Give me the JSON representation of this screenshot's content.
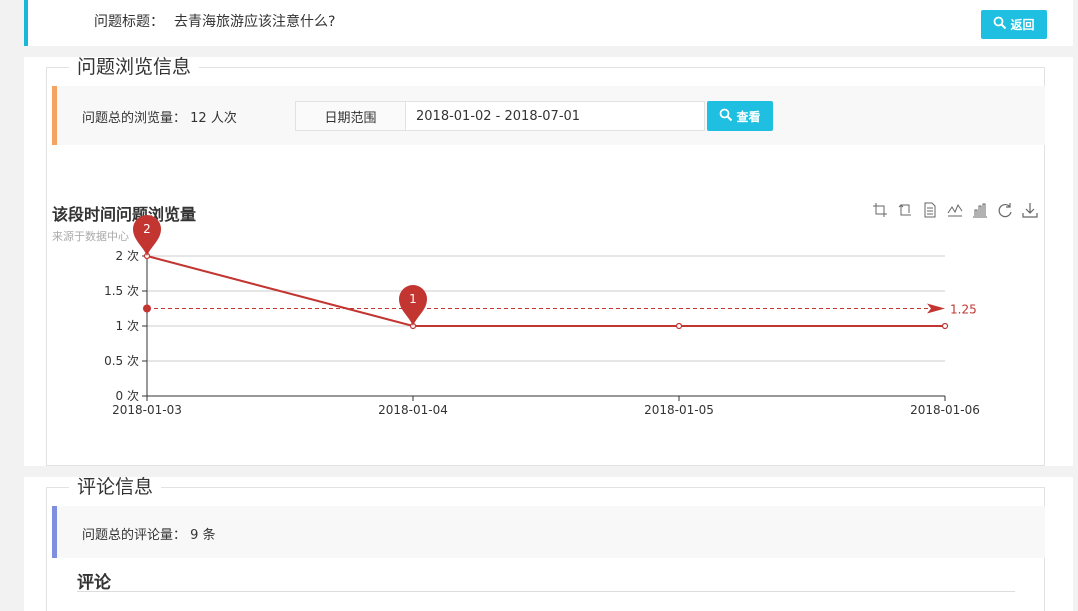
{
  "header": {
    "question_label": "问题标题：",
    "question_title": "去青海旅游应该注意什么?",
    "back_label": "返回"
  },
  "views_section": {
    "legend": "问题浏览信息",
    "total_views_label": "问题总的浏览量：",
    "total_views_value": "12 人次",
    "date_range_label": "日期范围",
    "date_range_value": "2018-01-02 - 2018-07-01",
    "view_button_label": "查看"
  },
  "chart_data": {
    "type": "line",
    "title": "该段时间问题浏览量",
    "subtitle": "来源于数据中心",
    "x": [
      "2018-01-03",
      "2018-01-04",
      "2018-01-05",
      "2018-01-06"
    ],
    "series": [
      {
        "values": [
          2,
          1,
          1,
          1
        ]
      }
    ],
    "ylim": [
      0,
      2
    ],
    "y_ticks": [
      "0 次",
      "0.5 次",
      "1 次",
      "1.5 次",
      "2 次"
    ],
    "mark_points": [
      {
        "label": "2",
        "index": 0
      },
      {
        "label": "1",
        "index": 1
      }
    ],
    "mark_line": {
      "label": "1.25",
      "value": 1.25
    },
    "grid": true,
    "color": "#c23531",
    "toolbox": [
      "data-zoom-icon",
      "zoom-reset-icon",
      "data-view-icon",
      "line-chart-icon",
      "bar-chart-icon",
      "restore-icon",
      "save-image-icon"
    ]
  },
  "comments_section": {
    "legend": "评论信息",
    "total_comments_label": "问题总的评论量：",
    "total_comments_value": "9 条",
    "heading": "评论"
  },
  "colors": {
    "accent": "#1ebfe0",
    "views_bar": "#f4a460",
    "comments_bar": "#7f8fe0"
  }
}
